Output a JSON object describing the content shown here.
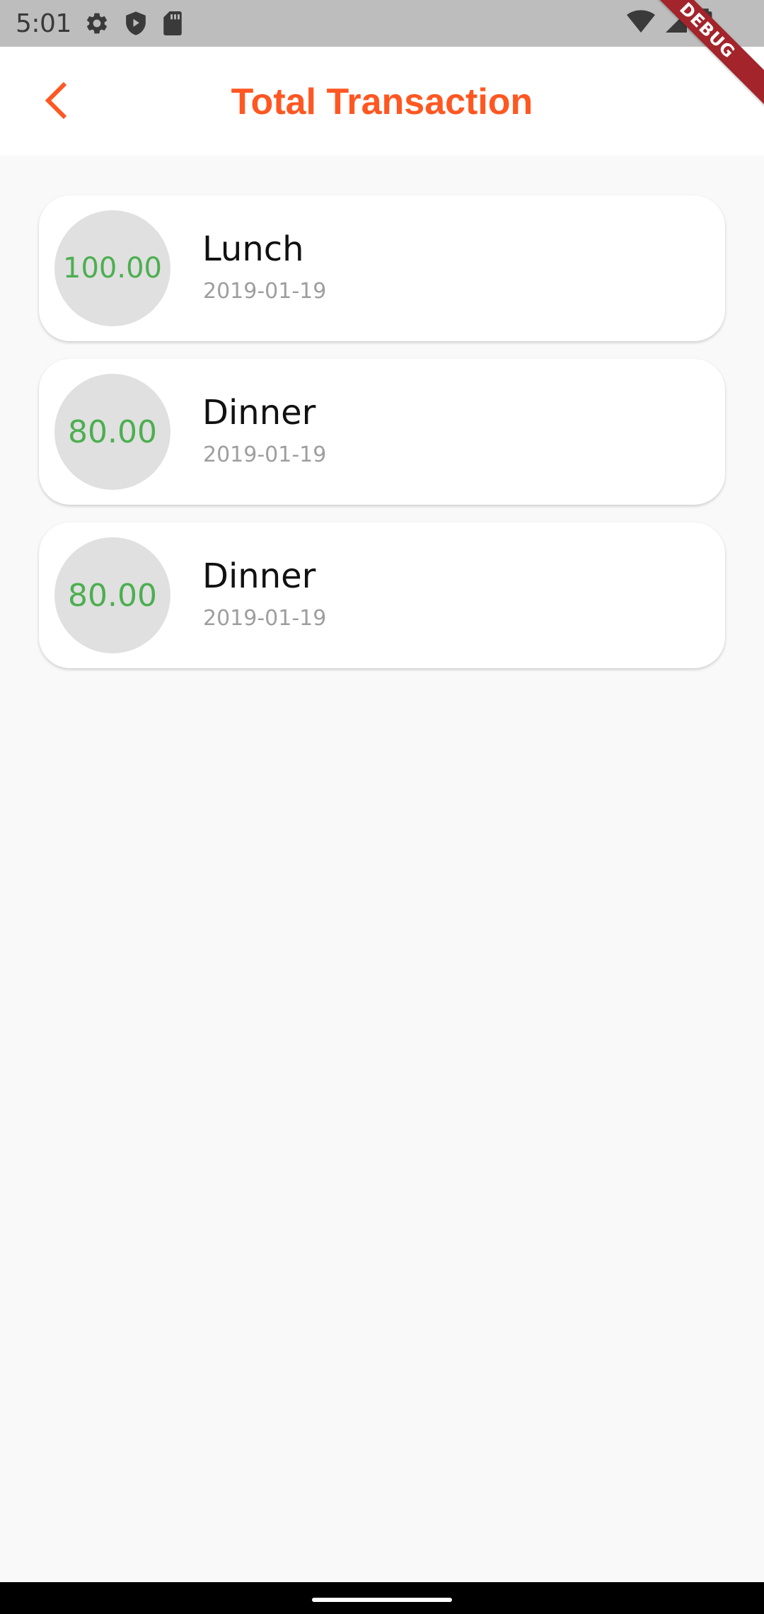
{
  "status_bar": {
    "time": "5:01",
    "left_icons": [
      "gear-icon",
      "shield-play-icon",
      "sd-card-icon"
    ],
    "right_icons": [
      "wifi-icon",
      "signal-icon",
      "battery-icon"
    ]
  },
  "debug_banner": {
    "label": "DEBUG"
  },
  "app_bar": {
    "title": "Total Transaction",
    "back_icon": "chevron-left-icon",
    "accent_color": "#ff5722"
  },
  "transactions": [
    {
      "amount": "100.00",
      "title": "Lunch",
      "date": "2019-01-19"
    },
    {
      "amount": "80.00",
      "title": "Dinner",
      "date": "2019-01-19"
    },
    {
      "amount": "80.00",
      "title": "Dinner",
      "date": "2019-01-19"
    }
  ],
  "colors": {
    "amount": "#4caf50",
    "circle_bg": "#e0e0e0",
    "date": "#9e9e9e",
    "background": "#f9f9f9"
  }
}
